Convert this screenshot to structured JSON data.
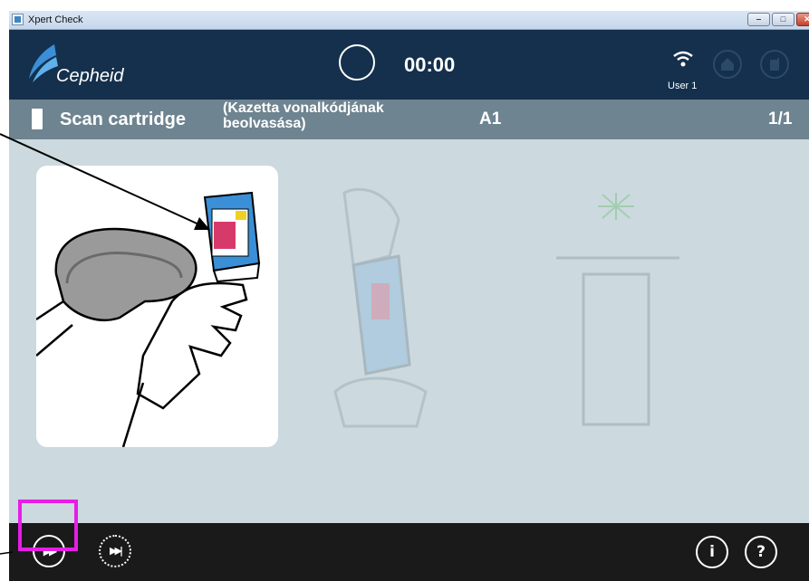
{
  "window": {
    "title": "Xpert Check",
    "minimize_label": "‒",
    "maximize_label": "□",
    "close_label": "✕"
  },
  "header": {
    "brand": "Cepheid",
    "timer": "00:00",
    "user": "User 1"
  },
  "step": {
    "title": "Scan cartridge",
    "subtitle_line1": "(Kazetta vonalkódjának",
    "subtitle_line2": "beolvasása)",
    "position": "A1",
    "count": "1/1"
  },
  "footer": {
    "next_glyph": "▶▶",
    "skip_glyph": "▶▶|",
    "info_glyph": "i",
    "help_glyph": "?"
  },
  "colors": {
    "header_bg": "#14304c",
    "step_bar_bg": "#6e8490",
    "content_bg": "#ccd9df",
    "footer_bg": "#1a1a1a",
    "highlight": "#e61ee6",
    "cartridge_blue": "#3a8fd6"
  },
  "icons": {
    "header": [
      "cepheid-logo",
      "timer-ring",
      "wifi-icon",
      "home-icon",
      "stop-icon"
    ],
    "footer": [
      "fast-forward-icon",
      "skip-to-end-icon",
      "info-icon",
      "help-icon"
    ]
  }
}
